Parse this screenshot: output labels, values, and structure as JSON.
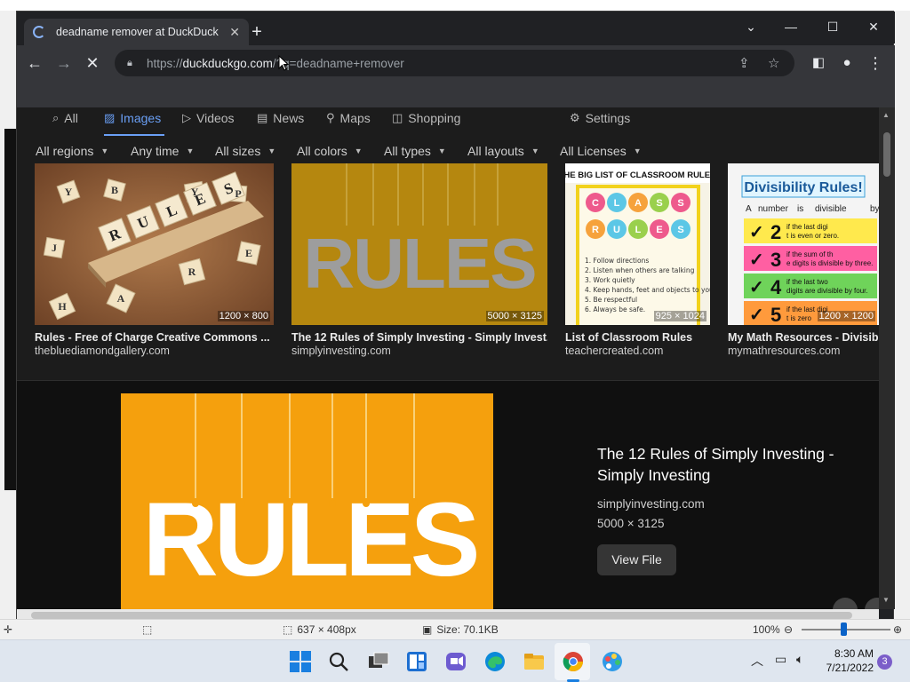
{
  "browser": {
    "tab": {
      "title": "deadname remover at DuckDuck"
    },
    "omnibox": {
      "scheme": "https://",
      "host": "duckduckgo.com",
      "path": "/?q=deadname+remover"
    }
  },
  "search_nav": {
    "tabs": [
      {
        "label": "All",
        "icon": "search-icon"
      },
      {
        "label": "Images",
        "icon": "image-icon"
      },
      {
        "label": "Videos",
        "icon": "play-icon"
      },
      {
        "label": "News",
        "icon": "news-icon"
      },
      {
        "label": "Maps",
        "icon": "map-pin-icon"
      },
      {
        "label": "Shopping",
        "icon": "bag-icon"
      }
    ],
    "settings": "Settings",
    "active_color": "#6a9ff5"
  },
  "filters": [
    "All regions",
    "Any time",
    "All sizes",
    "All colors",
    "All types",
    "All layouts",
    "All Licenses"
  ],
  "results": [
    {
      "title": "Rules - Free of Charge Creative Commons ...",
      "source": "thebluediamondgallery.com",
      "dims": "1200 × 800"
    },
    {
      "title": "The 12 Rules of Simply Investing - Simply Invest...",
      "source": "simplyinvesting.com",
      "dims": "5000 × 3125"
    },
    {
      "title": "List of Classroom Rules",
      "source": "teachercreated.com",
      "dims": "925 × 1024"
    },
    {
      "title": "My Math Resources - Divisibi...",
      "source": "mymathresources.com",
      "dims": "1200 × 1200"
    }
  ],
  "thumbs": {
    "scrabble": {
      "word": [
        "R",
        "U",
        "L",
        "E",
        "S"
      ],
      "letters": [
        "Y",
        "B",
        "J",
        "Y",
        "E",
        "H",
        "A",
        "R",
        "P"
      ]
    },
    "orange": {
      "word": "RULES"
    },
    "classroom": {
      "header": "THE BIG LIST OF CLASSROOM RULES",
      "bubbles": [
        "C",
        "L",
        "A",
        "S",
        "S",
        "R",
        "U",
        "L",
        "E",
        "S"
      ],
      "lines": [
        "1. Follow directions",
        "2. Listen when others are talking",
        "3. Work quietly",
        "4. Keep hands, feet and objects to yourself",
        "5. Be respectful",
        "6. Always be safe."
      ]
    },
    "divisibility": {
      "title": "Divisibility Rules!",
      "subtitle": [
        "A",
        "number",
        "is",
        "divisible",
        "by..."
      ],
      "rows": [
        {
          "n": "2",
          "text": "if the last digit is even or zero."
        },
        {
          "n": "3",
          "text": "if the sum of the digits is divisible by three."
        },
        {
          "n": "4",
          "text": "if the last two digits are divisible by four."
        },
        {
          "n": "5",
          "text": "if the last digit is zero"
        }
      ]
    }
  },
  "detail": {
    "title": "The 12 Rules of Simply Investing - Simply Investing",
    "source": "simplyinvesting.com",
    "dims": "5000 × 3125",
    "view_button": "View File",
    "image_word": "RULES"
  },
  "paint_status": {
    "dims": "637 × 408px",
    "size": "Size: 70.1KB",
    "zoom": "100%"
  },
  "taskbar": {
    "time": "8:30 AM",
    "date": "7/21/2022",
    "notifications": "3"
  }
}
